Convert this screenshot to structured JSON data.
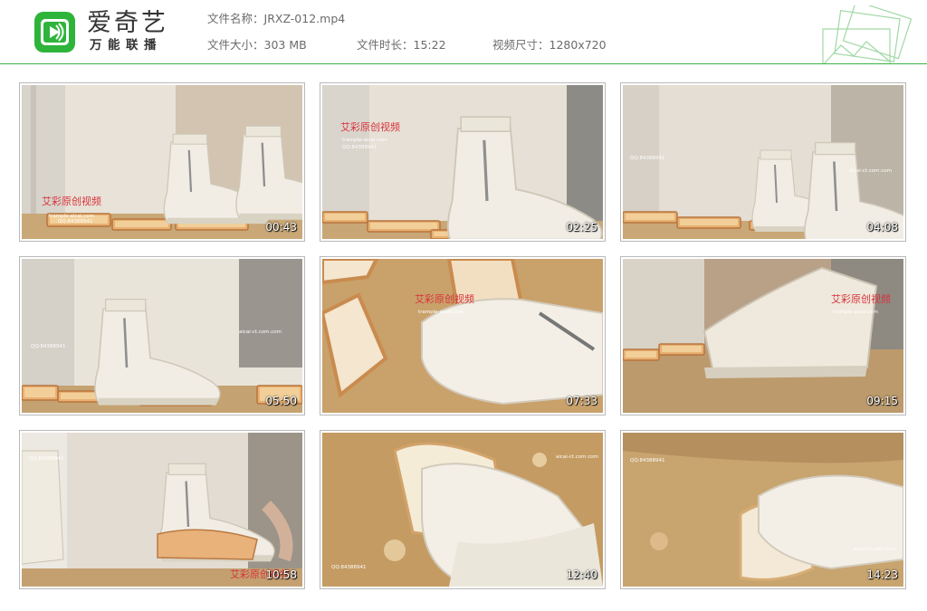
{
  "header": {
    "logo_title": "爱奇艺",
    "logo_subtitle": "万能联播",
    "file_name_label": "文件名称：",
    "file_name": "JRXZ-012.mp4",
    "file_size_label": "文件大小：",
    "file_size": "303 MB",
    "duration_label": "文件时长：",
    "duration": "15:22",
    "dimensions_label": "视频尺寸：",
    "dimensions": "1280x720"
  },
  "colors": {
    "brand_green": "#3cb44a",
    "info_text": "#6b6b6b"
  },
  "thumbnails": [
    {
      "timestamp": "00:43",
      "watermark": "艾彩原创视频",
      "url_text": "trample-aicai.com",
      "qq_text": "QQ:84388941"
    },
    {
      "timestamp": "02:25",
      "watermark": "艾彩原创视频",
      "url_text": "trample-aicai.com",
      "qq_text": "QQ:84388941"
    },
    {
      "timestamp": "04:08",
      "watermark": "",
      "url_text": "aicai-ct.com.com",
      "qq_text": "QQ:84388941"
    },
    {
      "timestamp": "05:50",
      "watermark": "",
      "url_text": "aicai-ct.com.com",
      "qq_text": "QQ:84388941"
    },
    {
      "timestamp": "07:33",
      "watermark": "艾彩原创视频",
      "url_text": "trample-aicai.com",
      "qq_text": ""
    },
    {
      "timestamp": "09:15",
      "watermark": "艾彩原创视频",
      "url_text": "trample-aicai.com",
      "qq_text": ""
    },
    {
      "timestamp": "10:58",
      "watermark": "艾彩原创视频",
      "url_text": "",
      "qq_text": "QQ:84388941"
    },
    {
      "timestamp": "12:40",
      "watermark": "",
      "url_text": "aicai-ct.com.com",
      "qq_text": "QQ:84388941"
    },
    {
      "timestamp": "14:23",
      "watermark": "",
      "url_text": "aicai-ct.com.com",
      "qq_text": "QQ:84388941"
    }
  ]
}
